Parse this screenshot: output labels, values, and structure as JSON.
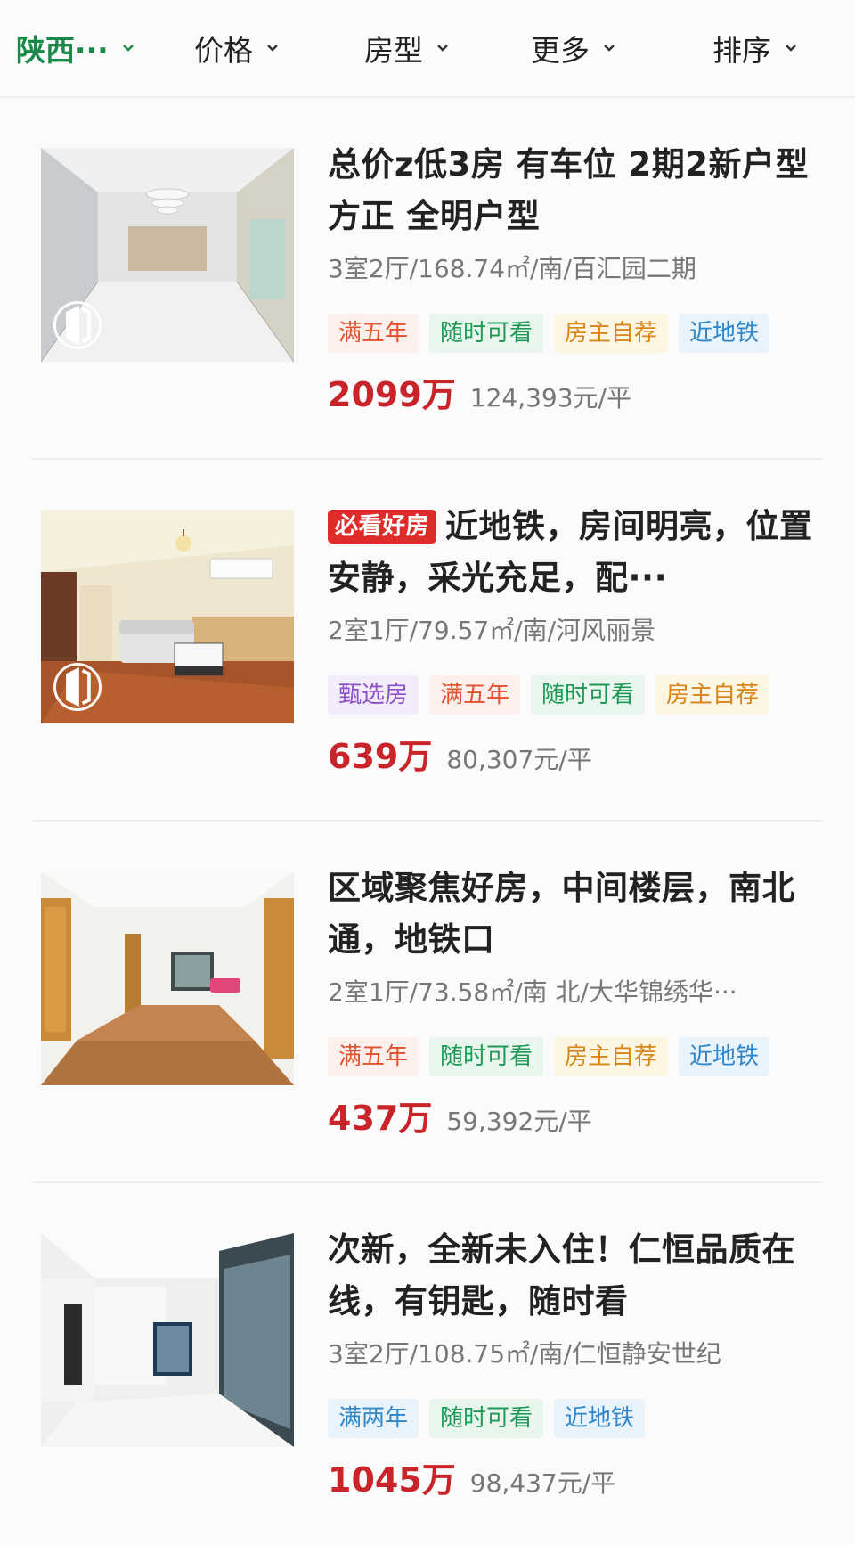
{
  "filters": [
    {
      "label": "陕西···",
      "active": true
    },
    {
      "label": "价格",
      "active": false
    },
    {
      "label": "房型",
      "active": false
    },
    {
      "label": "更多",
      "active": false
    },
    {
      "label": "排序",
      "active": false
    }
  ],
  "listings": [
    {
      "badge": "",
      "title": "总价z低3房 有车位 2期2新户型方正 全明户型",
      "meta": "3室2厅/168.74㎡/南/百汇园二期",
      "tags": [
        {
          "label": "满五年",
          "color": "red"
        },
        {
          "label": "随时可看",
          "color": "green"
        },
        {
          "label": "房主自荐",
          "color": "yellow"
        },
        {
          "label": "近地铁",
          "color": "blue"
        }
      ],
      "price": "2099万",
      "unit_price": "124,393元/平",
      "vr_icon": true
    },
    {
      "badge": "必看好房",
      "title": "近地铁，房间明亮，位置安静，采光充足，配···",
      "meta": "2室1厅/79.57㎡/南/河风丽景",
      "tags": [
        {
          "label": "甄选房",
          "color": "purple"
        },
        {
          "label": "满五年",
          "color": "red"
        },
        {
          "label": "随时可看",
          "color": "green"
        },
        {
          "label": "房主自荐",
          "color": "yellow"
        }
      ],
      "price": "639万",
      "unit_price": "80,307元/平",
      "vr_icon": true
    },
    {
      "badge": "",
      "title": "区域聚焦好房，中间楼层，南北通，地铁口",
      "meta": "2室1厅/73.58㎡/南 北/大华锦绣华···",
      "tags": [
        {
          "label": "满五年",
          "color": "red"
        },
        {
          "label": "随时可看",
          "color": "green"
        },
        {
          "label": "房主自荐",
          "color": "yellow"
        },
        {
          "label": "近地铁",
          "color": "blue"
        }
      ],
      "price": "437万",
      "unit_price": "59,392元/平",
      "vr_icon": false
    },
    {
      "badge": "",
      "title": "次新，全新未入住！仁恒品质在线，有钥匙，随时看",
      "meta": "3室2厅/108.75㎡/南/仁恒静安世纪",
      "tags": [
        {
          "label": "满两年",
          "color": "blue"
        },
        {
          "label": "随时可看",
          "color": "green"
        },
        {
          "label": "近地铁",
          "color": "blue"
        }
      ],
      "price": "1045万",
      "unit_price": "98,437元/平",
      "vr_icon": false
    }
  ]
}
